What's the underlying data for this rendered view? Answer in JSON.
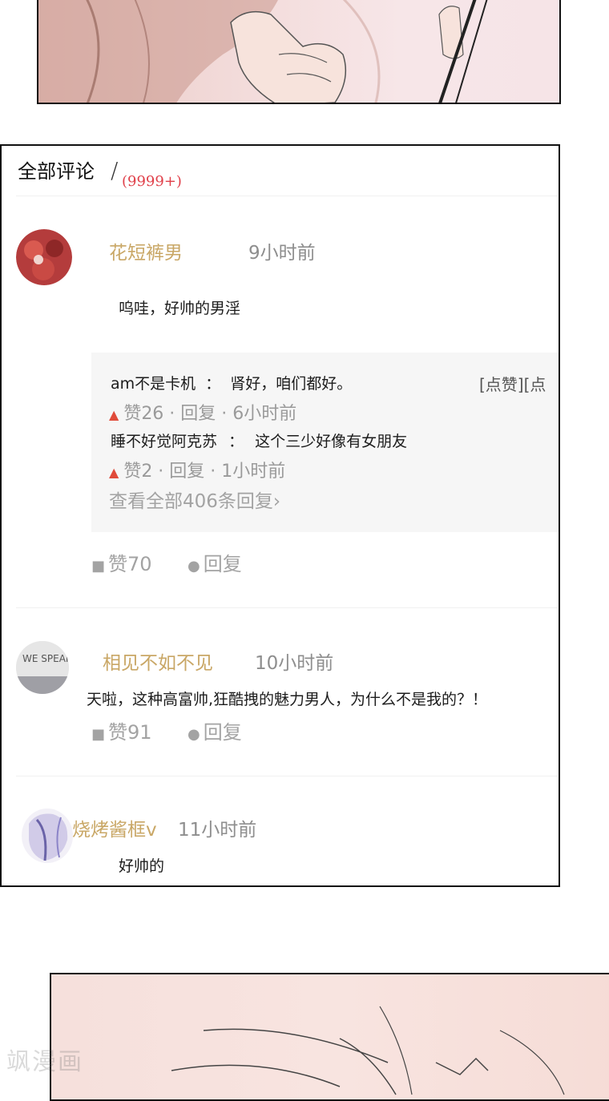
{
  "section_title": "全部评论",
  "section_separator": "/",
  "comment_count": "(9999+)",
  "comments": [
    {
      "user": "花短裤男",
      "time": "9小时前",
      "text": "呜哇，好帅的男淫",
      "replies": [
        {
          "user": "am不是卡机",
          "sep": "：",
          "text": "肾好，咱们都好。",
          "meta": "赞26 · 回复 · 6小时前"
        },
        {
          "user": "睡不好觉阿克苏",
          "sep": "：",
          "text": "这个三少好像有女朋友",
          "meta": "赞2 · 回复 · 1小时前"
        }
      ],
      "reply_actions": "[点赞][点",
      "view_all": "查看全部406条回复›",
      "likes": "赞70",
      "reply_label": "回复"
    },
    {
      "user": "相见不如不见",
      "time": "10小时前",
      "text": "天啦，这种高富帅,狂酷拽的魅力男人，为什么不是我的？！",
      "avatar_text": "WE SPEAK",
      "likes": "赞91",
      "reply_label": "回复"
    },
    {
      "user": "烧烤酱框v",
      "time": "11小时前",
      "text": "好帅的"
    }
  ],
  "icons": {
    "like": "thumbs-up-icon",
    "reply": "speech-bubble-icon",
    "flame": "flame-icon"
  },
  "colors": {
    "username": "#c9a766",
    "count": "#e0404a",
    "flame": "#e04b3a"
  },
  "watermark": "飒漫画"
}
